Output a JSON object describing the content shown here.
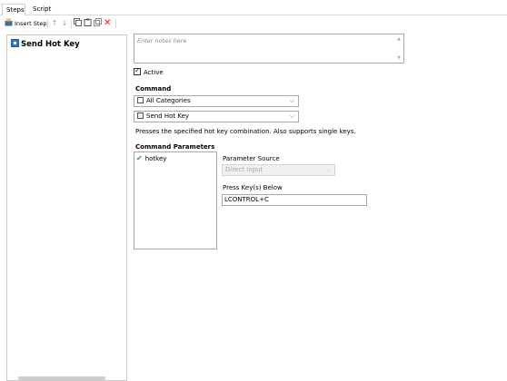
{
  "tabs": [
    {
      "label": "Steps"
    },
    {
      "label": "Script"
    }
  ],
  "toolbar": {
    "insert_step_label": "Insert Step",
    "icons": [
      "insert-step-icon",
      "arrow-up-icon",
      "arrow-down-icon",
      "copy-icon",
      "paste-icon",
      "duplicate-icon",
      "delete-icon"
    ],
    "delete_color": "#e81123"
  },
  "steps": {
    "items": [
      {
        "label": "Send Hot Key",
        "icon": "send-hot-key-icon"
      }
    ]
  },
  "notes": {
    "placeholder": "Enter notes here"
  },
  "active": {
    "label": "Active",
    "checked": true
  },
  "command": {
    "heading": "Command",
    "category_value": "All Categories",
    "command_value": "Send Hot Key",
    "description": "Presses the specified hot key combination. Also supports single keys."
  },
  "parameters": {
    "heading": "Command Parameters",
    "items": [
      {
        "label": "hotkey",
        "status": "valid"
      }
    ],
    "source_label": "Parameter Source",
    "source_value": "Direct Input",
    "keys_label": "Press Key(s) Below",
    "keys_value": "LCONTROL+C"
  },
  "colors": {
    "accent": "#2b78c5",
    "check_green": "#2e9d3a",
    "border": "#a9a9a9"
  }
}
